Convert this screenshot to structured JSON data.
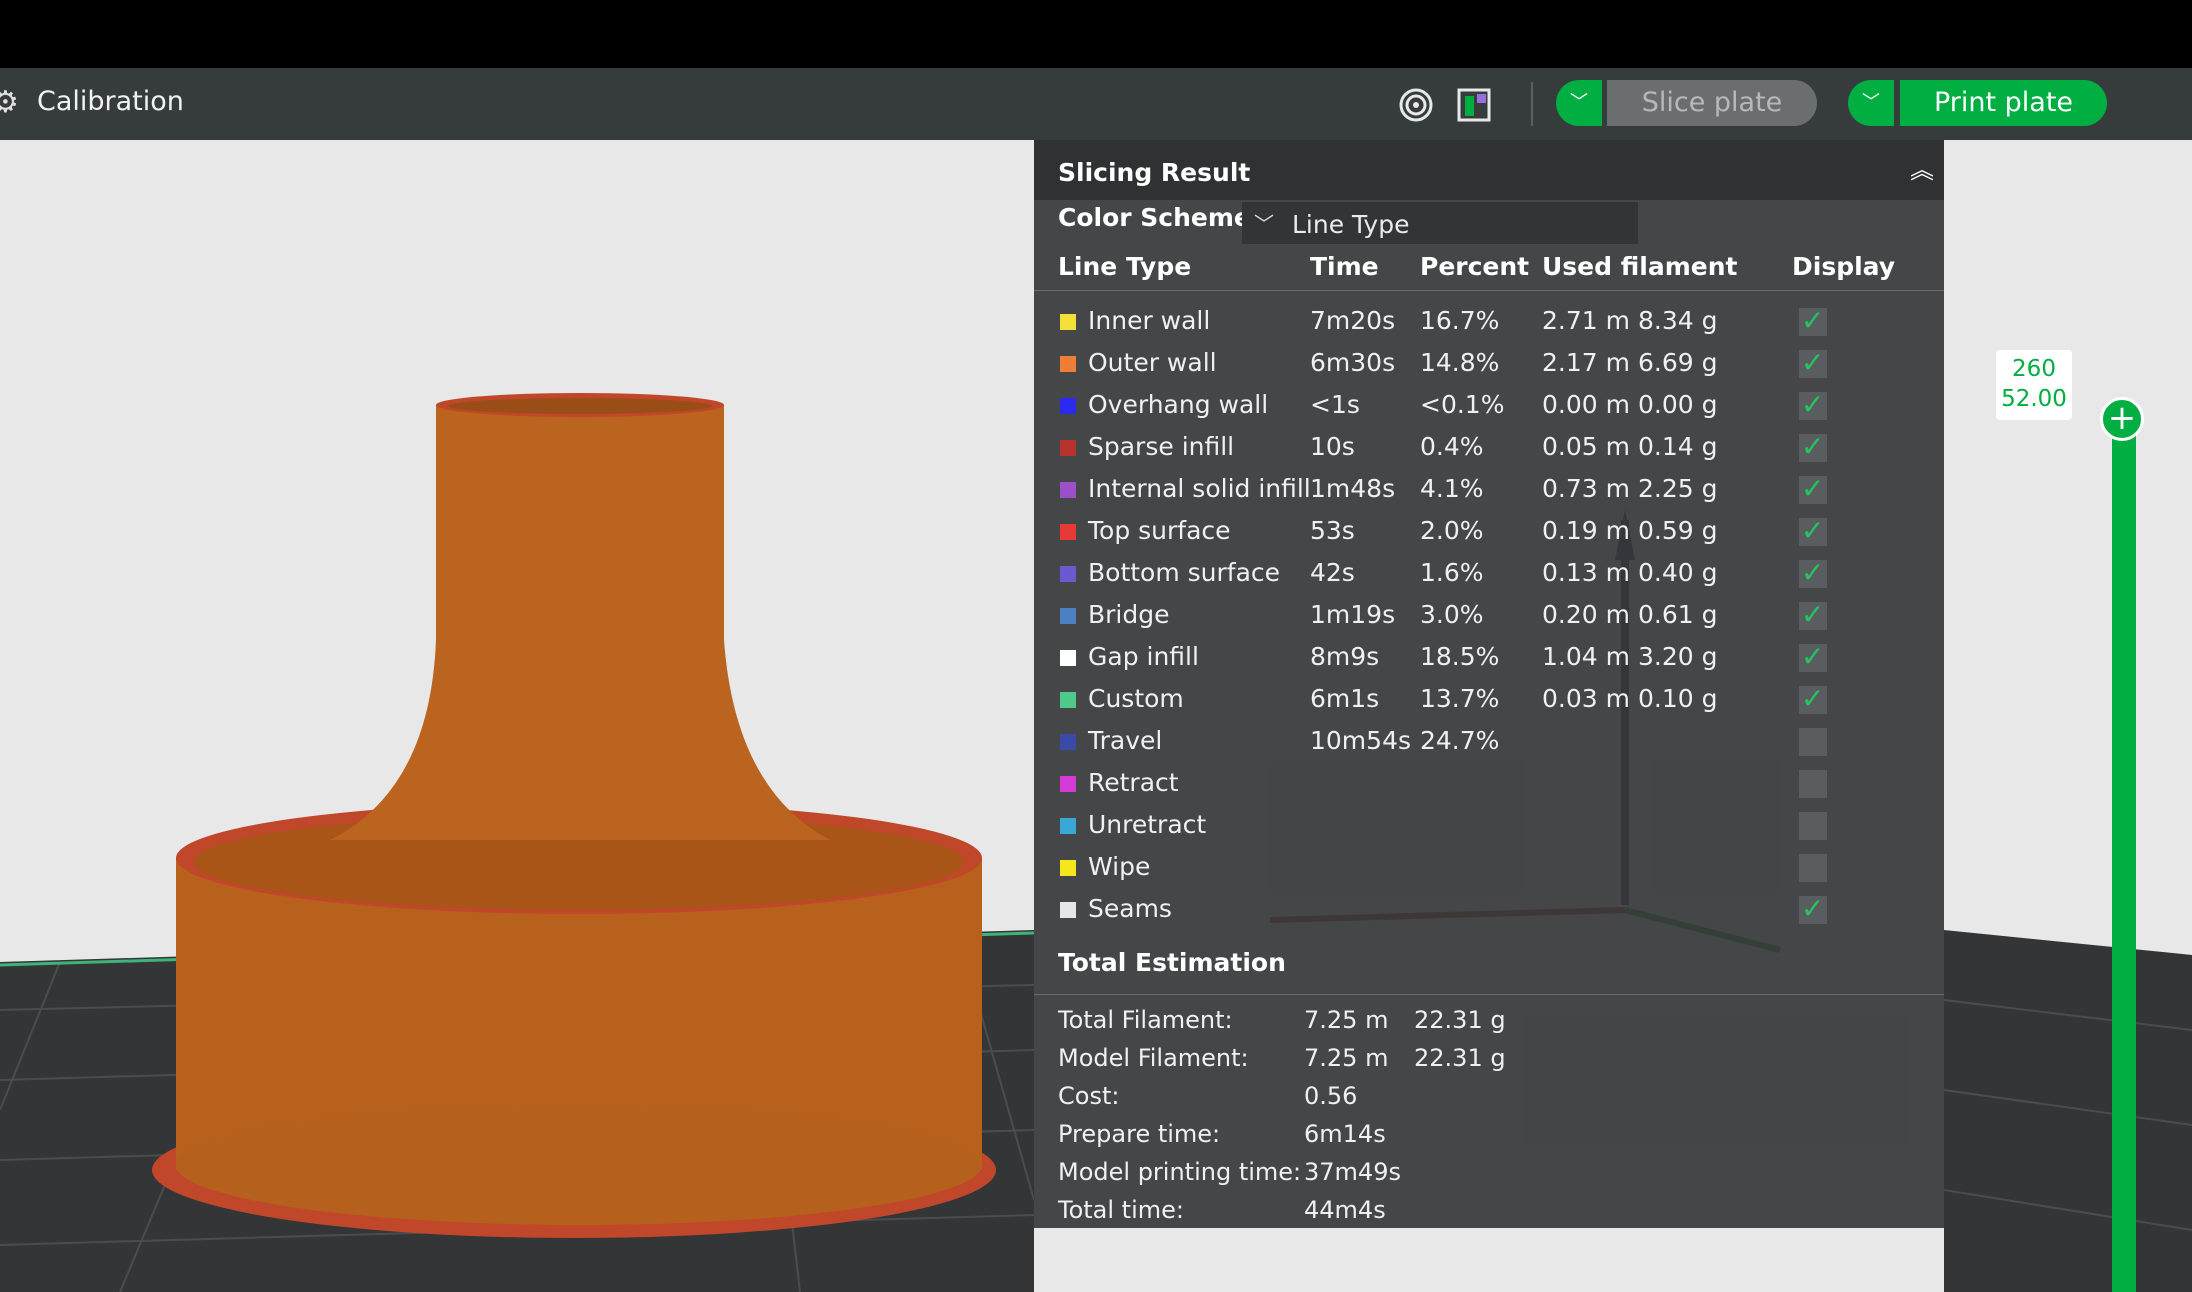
{
  "toolbar": {
    "calibration_label": "Calibration",
    "slice_label": "Slice plate",
    "print_label": "Print plate",
    "colors": {
      "green": "#00ae42",
      "toolbar": "#363b3c"
    }
  },
  "panel": {
    "title": "Slicing Result",
    "color_scheme_label": "Color Scheme",
    "color_scheme_value": "Line Type",
    "headers": {
      "line_type": "Line Type",
      "time": "Time",
      "percent": "Percent",
      "used_filament": "Used filament",
      "display": "Display"
    },
    "rows": [
      {
        "name": "Inner wall",
        "color": "#f5e03a",
        "time": "7m20s",
        "percent": "16.7%",
        "length": "2.71 m",
        "weight": "8.34 g",
        "checked": true
      },
      {
        "name": "Outer wall",
        "color": "#f07d35",
        "time": "6m30s",
        "percent": "14.8%",
        "length": "2.17 m",
        "weight": "6.69 g",
        "checked": true
      },
      {
        "name": "Overhang wall",
        "color": "#2a2af0",
        "time": "<1s",
        "percent": "<0.1%",
        "length": "0.00 m",
        "weight": "0.00 g",
        "checked": true
      },
      {
        "name": "Sparse infill",
        "color": "#b8332e",
        "time": "10s",
        "percent": "0.4%",
        "length": "0.05 m",
        "weight": "0.14 g",
        "checked": true
      },
      {
        "name": "Internal solid infill",
        "color": "#9b4fc9",
        "time": "1m48s",
        "percent": "4.1%",
        "length": "0.73 m",
        "weight": "2.25 g",
        "checked": true
      },
      {
        "name": "Top surface",
        "color": "#e63a3a",
        "time": "53s",
        "percent": "2.0%",
        "length": "0.19 m",
        "weight": "0.59 g",
        "checked": true
      },
      {
        "name": "Bottom surface",
        "color": "#6a5ad1",
        "time": "42s",
        "percent": "1.6%",
        "length": "0.13 m",
        "weight": "0.40 g",
        "checked": true
      },
      {
        "name": "Bridge",
        "color": "#4d80c2",
        "time": "1m19s",
        "percent": "3.0%",
        "length": "0.20 m",
        "weight": "0.61 g",
        "checked": true
      },
      {
        "name": "Gap infill",
        "color": "#ffffff",
        "time": "8m9s",
        "percent": "18.5%",
        "length": "1.04 m",
        "weight": "3.20 g",
        "checked": true
      },
      {
        "name": "Custom",
        "color": "#4ec98a",
        "time": "6m1s",
        "percent": "13.7%",
        "length": "0.03 m",
        "weight": "0.10 g",
        "checked": true
      },
      {
        "name": "Travel",
        "color": "#3a4aa8",
        "time": "10m54s",
        "percent": "24.7%",
        "length": "",
        "weight": "",
        "checked": false
      },
      {
        "name": "Retract",
        "color": "#d63ad6",
        "time": "",
        "percent": "",
        "length": "",
        "weight": "",
        "checked": false
      },
      {
        "name": "Unretract",
        "color": "#3aa8d6",
        "time": "",
        "percent": "",
        "length": "",
        "weight": "",
        "checked": false
      },
      {
        "name": "Wipe",
        "color": "#f5e61e",
        "time": "",
        "percent": "",
        "length": "",
        "weight": "",
        "checked": false
      },
      {
        "name": "Seams",
        "color": "#e6e6e6",
        "time": "",
        "percent": "",
        "length": "",
        "weight": "",
        "checked": true
      }
    ],
    "total": {
      "title": "Total Estimation",
      "rows": [
        {
          "label": "Total Filament:",
          "v1": "7.25 m",
          "v2": "22.31 g"
        },
        {
          "label": "Model Filament:",
          "v1": "7.25 m",
          "v2": "22.31 g"
        },
        {
          "label": "Cost:",
          "v1": "0.56",
          "v2": ""
        },
        {
          "label": "Prepare time:",
          "v1": "6m14s",
          "v2": ""
        },
        {
          "label": "Model printing time:",
          "v1": "37m49s",
          "v2": ""
        },
        {
          "label": "Total time:",
          "v1": "44m4s",
          "v2": ""
        }
      ]
    }
  },
  "layer_slider": {
    "layer": "260",
    "height": "52.00"
  },
  "icons": [
    "gear-icon",
    "auto-orient-icon",
    "plate-layout-icon",
    "chevron-down-icon",
    "collapse-icon",
    "plus-icon"
  ]
}
